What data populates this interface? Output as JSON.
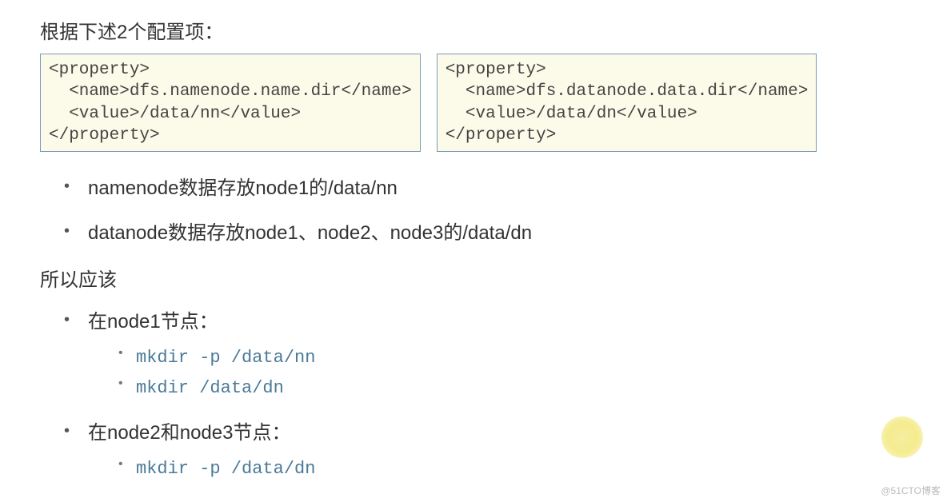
{
  "heading": "根据下述2个配置项：",
  "configs": [
    "<property>\n  <name>dfs.namenode.name.dir</name>\n  <value>/data/nn</value>\n</property>",
    "<property>\n  <name>dfs.datanode.data.dir</name>\n  <value>/data/dn</value>\n</property>"
  ],
  "bullets": [
    "namenode数据存放node1的/data/nn",
    "datanode数据存放node1、node2、node3的/data/dn"
  ],
  "subheading": "所以应该",
  "nodes": [
    {
      "label": "在node1节点：",
      "cmds": [
        "mkdir -p /data/nn",
        "mkdir /data/dn"
      ]
    },
    {
      "label": "在node2和node3节点：",
      "cmds": [
        "mkdir -p /data/dn"
      ]
    }
  ],
  "watermark": "@51CTO博客"
}
